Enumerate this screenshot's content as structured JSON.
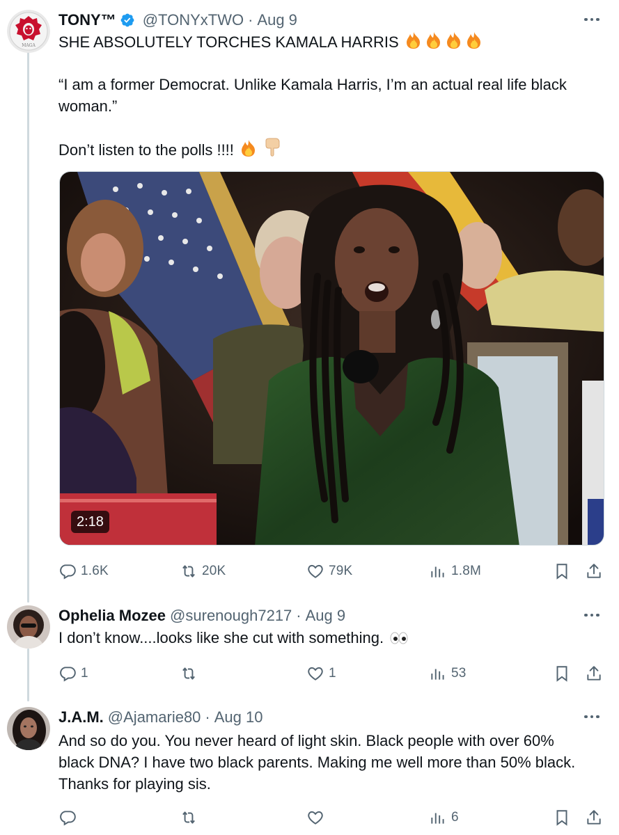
{
  "posts": [
    {
      "author": {
        "name": "TONY™",
        "handle": "@TONYxTWO",
        "date": "Aug 9",
        "verified": true,
        "avatar_text": "MAGA"
      },
      "text_lines": [
        "SHE ABSOLUTELY TORCHES KAMALA HARRIS",
        "“I am a former Democrat. Unlike Kamala Harris, I’m an actual real life black",
        "woman.”",
        "Don’t listen to the polls !!!!"
      ],
      "media": {
        "duration": "2:18"
      },
      "stats": {
        "replies": "1.6K",
        "reposts": "20K",
        "likes": "79K",
        "views": "1.8M"
      }
    },
    {
      "author": {
        "name": "Ophelia Mozee",
        "handle": "@surenough7217",
        "date": "Aug 9"
      },
      "text_lines": [
        "I don’t know....looks like she cut with something."
      ],
      "stats": {
        "replies": "1",
        "reposts": "",
        "likes": "1",
        "views": "53"
      }
    },
    {
      "author": {
        "name": "J.A.M.",
        "handle": "@Ajamarie80",
        "date": "Aug 10"
      },
      "text_lines": [
        "And so do you. You never heard of light skin. Black people with over 60%",
        "black DNA? I have two black parents. Making me well more than 50% black.",
        "Thanks for playing sis."
      ],
      "stats": {
        "replies": "",
        "reposts": "",
        "likes": "",
        "views": "6"
      }
    }
  ],
  "icons": {
    "reply": "reply-icon",
    "repost": "repost-icon",
    "like": "heart-icon",
    "views": "views-icon",
    "bookmark": "bookmark-icon",
    "share": "share-icon",
    "verified": "verified-badge-icon",
    "more": "more-icon",
    "fire": "fire-emoji-icon",
    "point_down": "pointing-down-emoji-icon",
    "eyes": "eyes-emoji-icon"
  },
  "colors": {
    "verified": "#1d9bf0",
    "secondary_text": "#536471",
    "thread_line": "#cfd9de"
  }
}
